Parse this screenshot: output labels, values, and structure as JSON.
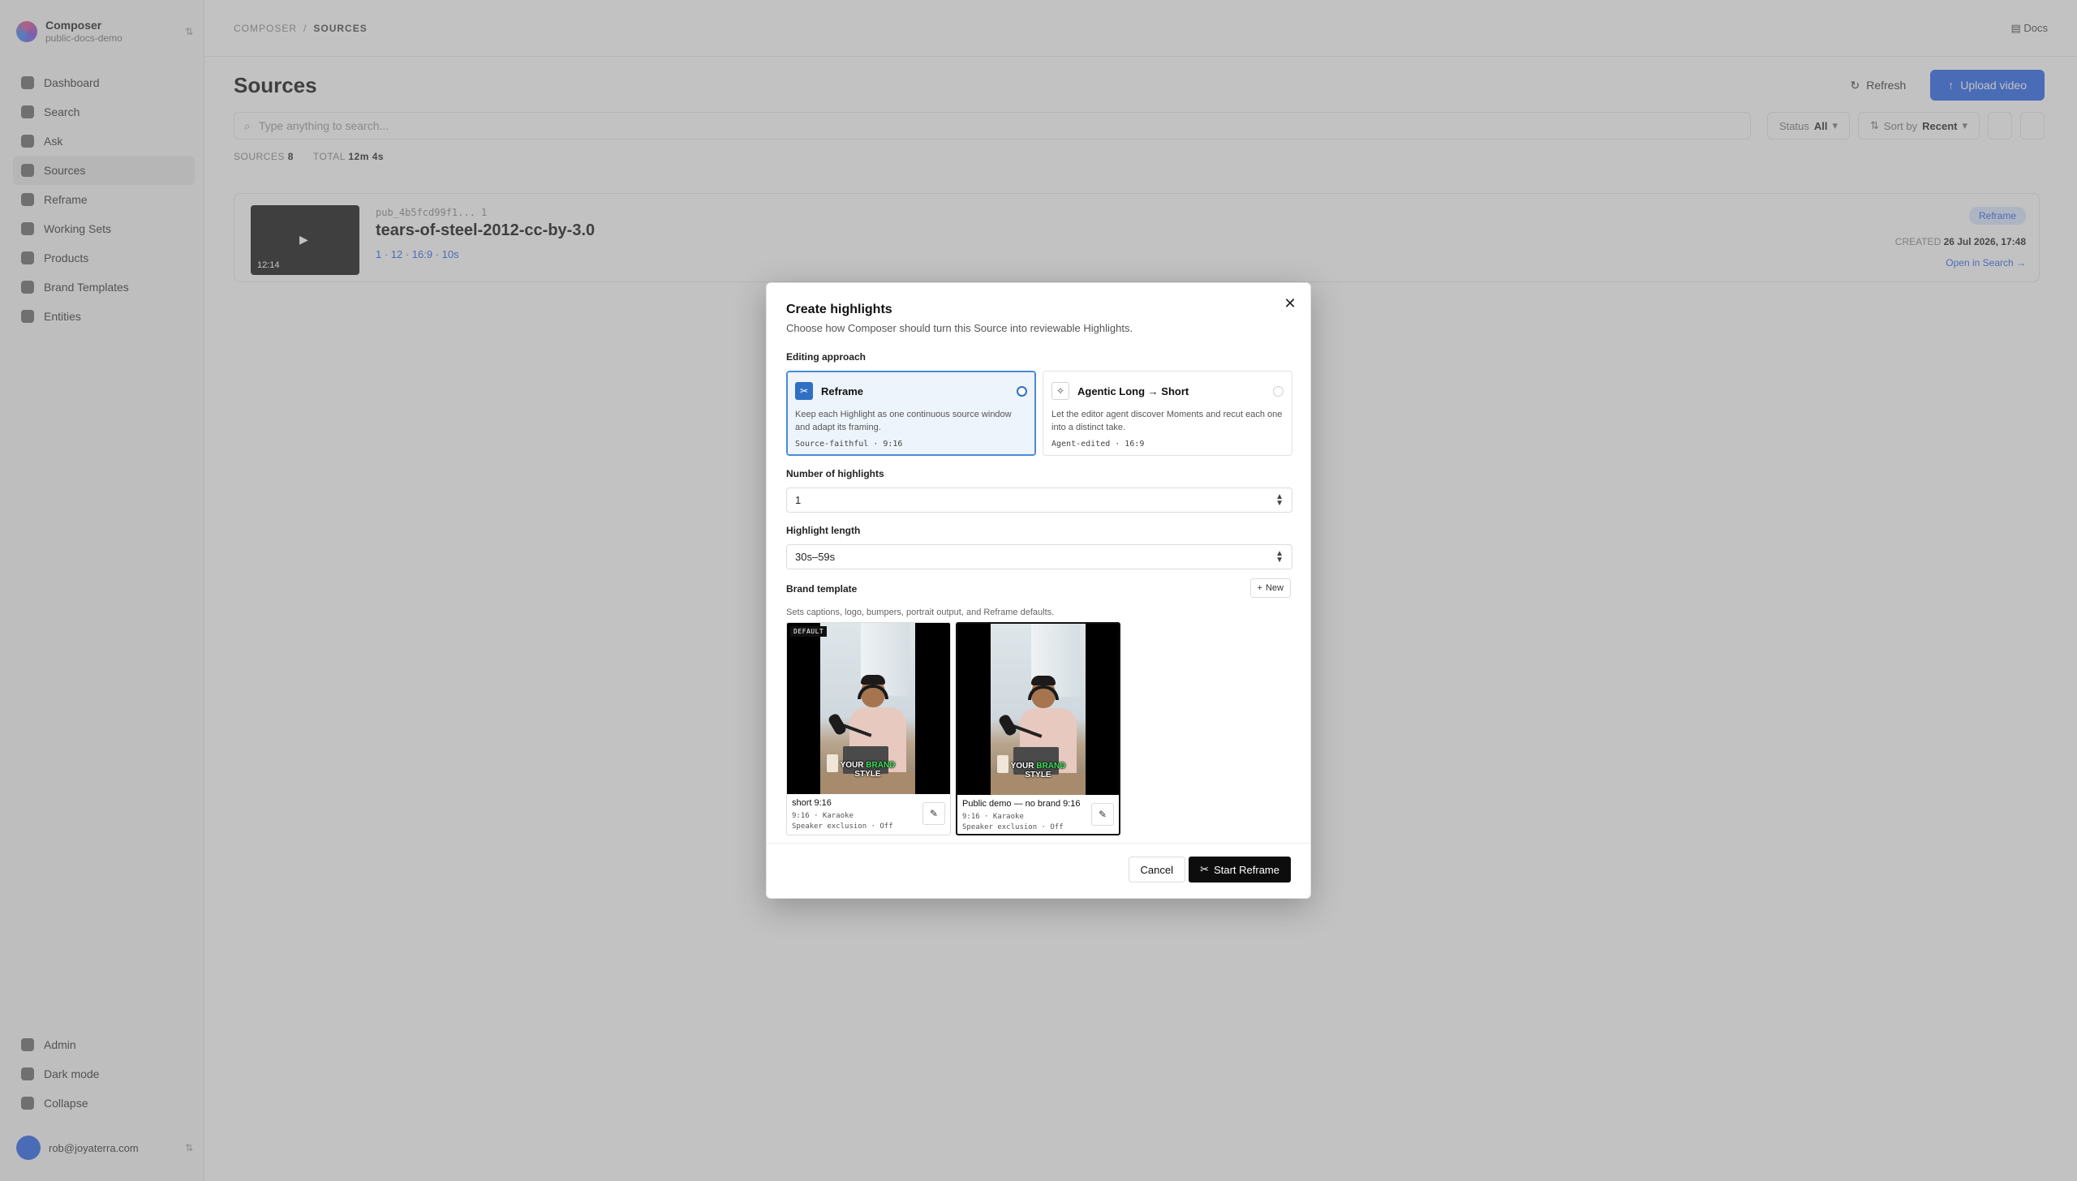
{
  "app": {
    "workspace_name": "Composer",
    "workspace_sub": "public-docs-demo",
    "breadcrumb": [
      "COMPOSER",
      "SOURCES"
    ],
    "docs_label": "Docs",
    "user_email": "rob@joyaterra.com"
  },
  "sidebar": {
    "items": [
      {
        "label": "Dashboard"
      },
      {
        "label": "Search"
      },
      {
        "label": "Ask"
      },
      {
        "label": "Sources"
      },
      {
        "label": "Reframe"
      },
      {
        "label": "Working Sets"
      },
      {
        "label": "Products"
      },
      {
        "label": "Brand Templates"
      },
      {
        "label": "Entities"
      }
    ],
    "bottom_items": [
      {
        "label": "Admin"
      },
      {
        "label": "Dark mode"
      },
      {
        "label": "Collapse"
      }
    ]
  },
  "page": {
    "title": "Sources",
    "refresh_label": "Refresh",
    "upload_label": "Upload video",
    "search_placeholder": "Type anything to search...",
    "status_filter_label": "Status",
    "status_filter_value": "All",
    "sort_label": "Sort by",
    "sort_value": "Recent",
    "stat_sources_label": "SOURCES",
    "stat_sources_value": "8",
    "stat_total_label": "TOTAL",
    "stat_total_value": "12m 4s"
  },
  "source_card": {
    "id_text": "pub_4b5fcd99f1... 1",
    "title": "tears-of-steel-2012-cc-by-3.0",
    "link_text": "1 · 12 · 16:9 · 10s",
    "duration": "12:14",
    "badge": "Reframe",
    "created_label": "CREATED",
    "created_value": "26 Jul 2026, 17:48",
    "open_label": "Open in Search →"
  },
  "dialog": {
    "title": "Create highlights",
    "subtitle": "Choose how Composer should turn this Source into reviewable Highlights.",
    "approach_label": "Editing approach",
    "approaches": [
      {
        "title": "Reframe",
        "description": "Keep each Highlight as one continuous source window and adapt its framing.",
        "tag": "Source-faithful · 9:16",
        "selected": true
      },
      {
        "title": "Agentic Long → Short",
        "description": "Let the editor agent discover Moments and recut each one into a distinct take.",
        "tag": "Agent-edited · 16:9",
        "selected": false
      }
    ],
    "count_label": "Number of highlights",
    "count_value": "1",
    "length_label": "Highlight length",
    "length_value": "30s–59s",
    "brand_label": "Brand template",
    "new_label": "New",
    "brand_help": "Sets captions, logo, bumpers, portrait output, and Reframe defaults.",
    "templates": [
      {
        "name": "short 9:16",
        "meta1": "9:16 · Karaoke",
        "meta2": "Speaker exclusion · Off",
        "badge": "DEFAULT",
        "caption_pre": "YOUR",
        "caption_hl": "BRAND",
        "caption_post": "STYLE",
        "selected": false
      },
      {
        "name": "Public demo — no brand 9:16",
        "meta1": "9:16 · Karaoke",
        "meta2": "Speaker exclusion · Off",
        "caption_pre": "YOUR",
        "caption_hl": "BRAND",
        "caption_post": "STYLE",
        "selected": true
      }
    ],
    "cancel_label": "Cancel",
    "start_label": "Start Reframe"
  },
  "colors": {
    "accent": "#2563eb",
    "selected_border": "#4a8ad8",
    "primary_button": "#0d0d0d",
    "caption_highlight": "#3ee05c"
  }
}
